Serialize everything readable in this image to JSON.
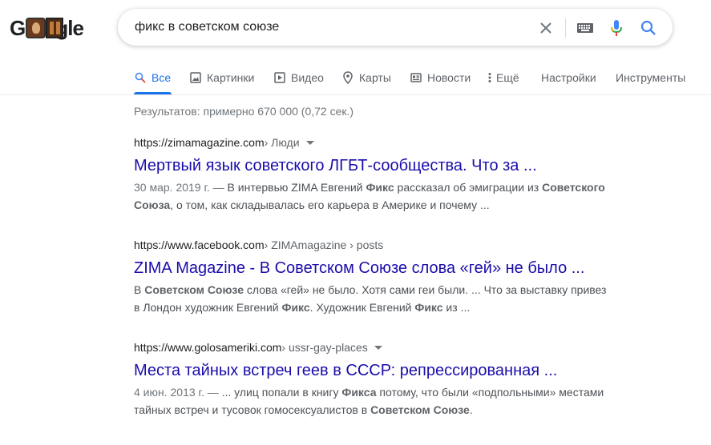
{
  "logo": {
    "first": "G",
    "rest": "gle"
  },
  "search": {
    "query": "фикс в советском союзе"
  },
  "tabs": [
    {
      "label": "Все",
      "icon": "search-icon"
    },
    {
      "label": "Картинки",
      "icon": "image-icon"
    },
    {
      "label": "Видео",
      "icon": "video-icon"
    },
    {
      "label": "Карты",
      "icon": "map-pin-icon"
    },
    {
      "label": "Новости",
      "icon": "news-icon"
    },
    {
      "label": "Ещё",
      "icon": "more-vert-icon"
    },
    {
      "label": "Настройки"
    },
    {
      "label": "Инструменты"
    }
  ],
  "stats": "Результатов: примерно 670 000 (0,72 сек.) ",
  "results": [
    {
      "url": "https://zimamagazine.com",
      "breadcrumb": " › Люди",
      "title": "Мертвый язык советского ЛГБТ-сообщества. Что за ...",
      "date": "30 мар. 2019 г. — ",
      "snippet": [
        {
          "t": "В интервью ZIMA Евгений "
        },
        {
          "b": "Фикс"
        },
        {
          "t": " рассказал об эмиграции из "
        },
        {
          "b": "Советского Союза"
        },
        {
          "t": ", о том, как складывалась его карьера в Америке и почему ..."
        }
      ]
    },
    {
      "url": "https://www.facebook.com",
      "breadcrumb": " › ZIMAmagazine › posts",
      "title": "ZIMA Magazine - В Советском Союзе слова «гей» не было ...",
      "date": "",
      "snippet": [
        {
          "t": "В "
        },
        {
          "b": "Советском Союзе"
        },
        {
          "t": " слова «гей» не было. Хотя сами геи были. ... Что за выставку привез в Лондон художник Евгений "
        },
        {
          "b": "Фикс"
        },
        {
          "t": ". Художник Евгений "
        },
        {
          "b": "Фикс"
        },
        {
          "t": " из ..."
        }
      ]
    },
    {
      "url": "https://www.golosameriki.com",
      "breadcrumb": " › ussr-gay-places",
      "title": "Места тайных встреч геев в СССР: репрессированная ...",
      "date": "4 июн. 2013 г. — ",
      "snippet": [
        {
          "t": "... улиц попали в книгу "
        },
        {
          "b": "Фикса"
        },
        {
          "t": " потому, что были «подпольными» местами тайных встреч и тусовок гомосексуалистов в "
        },
        {
          "b": "Советском Союзе"
        },
        {
          "t": "."
        }
      ]
    }
  ],
  "colors": {
    "link": "#1a0dab",
    "accent": "#1a73e8",
    "secondary": "#5f6368"
  }
}
